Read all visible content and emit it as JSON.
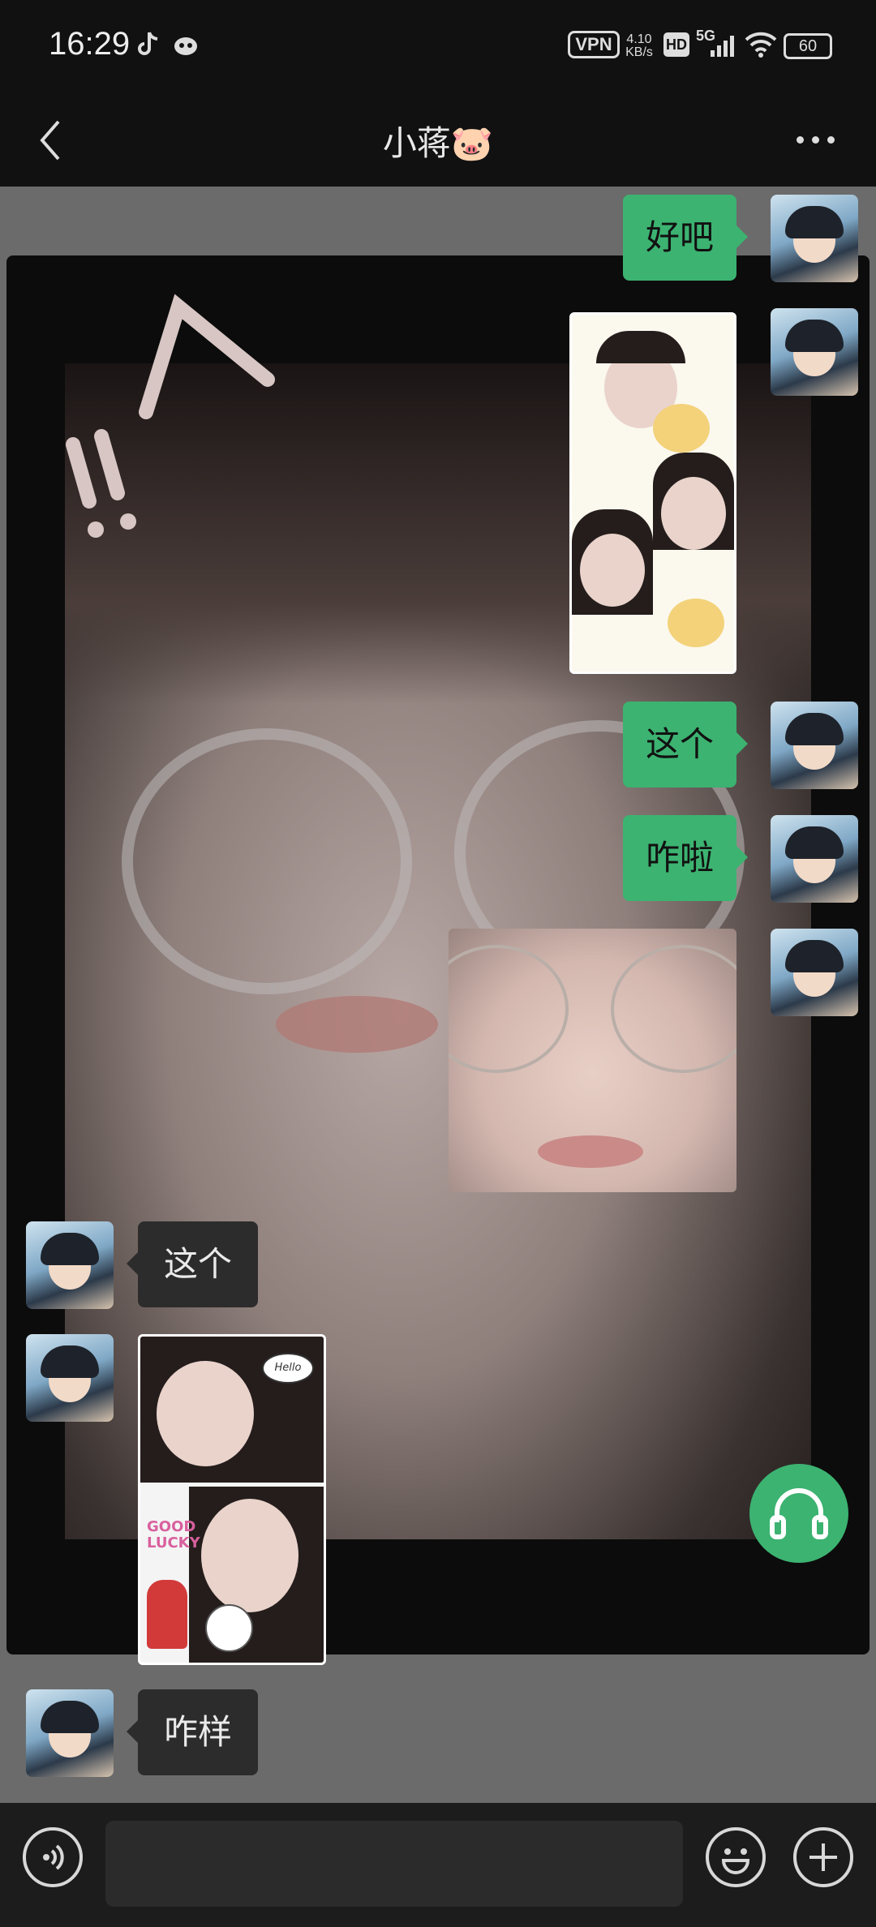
{
  "status_bar": {
    "time": "16:29",
    "vpn": "VPN",
    "net_speed_value": "4.10",
    "net_speed_unit": "KB/s",
    "hd": "HD",
    "signal": "5G",
    "battery": "60",
    "icons": [
      "tiktok-icon",
      "app-notification-icon",
      "signal-icon",
      "wifi-icon",
      "battery-icon"
    ]
  },
  "header": {
    "title": "小蒋🐷",
    "back_icon": "chevron-left-icon",
    "more_icon": "more-dots-icon"
  },
  "messages": [
    {
      "side": "out",
      "type": "text",
      "text": "好吧"
    },
    {
      "side": "out",
      "type": "sticker",
      "icon": "photo-collage-sticker"
    },
    {
      "side": "out",
      "type": "text",
      "text": "这个"
    },
    {
      "side": "out",
      "type": "text",
      "text": "咋啦"
    },
    {
      "side": "out",
      "type": "sticker",
      "icon": "face-photo-sticker"
    },
    {
      "side": "in",
      "type": "text",
      "text": "这个"
    },
    {
      "side": "in",
      "type": "sticker",
      "icon": "photo-collage-sticker"
    },
    {
      "side": "in",
      "type": "text",
      "text": "咋样"
    }
  ],
  "sticker_texts": {
    "hello": "Hello",
    "good_lucky": "GOOD LUCKY"
  },
  "fab": {
    "icon": "headphones-icon"
  },
  "input_bar": {
    "voice_icon": "voice-icon",
    "input_value": "",
    "emoji_icon": "emoji-icon",
    "plus_icon": "plus-icon"
  },
  "colors": {
    "accent_green": "#3cb371",
    "incoming_bubble": "#2c2c2c",
    "chat_background": "#6b6b6b",
    "bar_background": "#111111"
  }
}
